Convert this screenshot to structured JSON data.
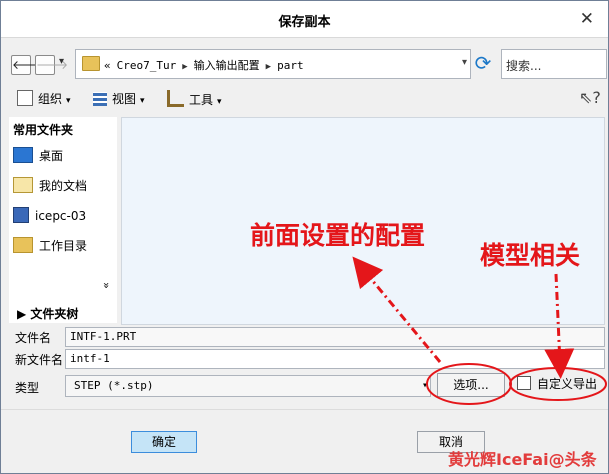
{
  "window": {
    "title": "保存副本",
    "close_glyph": "✕"
  },
  "nav": {
    "back_glyph": "🡐",
    "forward_glyph": "🡒",
    "dropdown_glyph": "▾"
  },
  "path": {
    "prefix": "«",
    "crumbs": [
      "Creo7_Tur",
      "输入输出配置",
      "part"
    ],
    "sep": "▶",
    "refresh_glyph": "⟳"
  },
  "search": {
    "placeholder": "搜索..."
  },
  "toolbar": {
    "organize": "组织",
    "view": "视图",
    "tools": "工具",
    "help_glyph": "⇖?"
  },
  "sidebar": {
    "heading": "常用文件夹",
    "items": [
      "桌面",
      "我的文档",
      "icepc-03",
      "工作目录"
    ],
    "more_glyph": "»",
    "tree_label": "文件夹树"
  },
  "fields": {
    "filename_label": "文件名",
    "filename_value": "INTF-1.PRT",
    "newname_label": "新文件名",
    "newname_value": "intf-1",
    "type_label": "类型",
    "type_value": "STEP (*.stp)"
  },
  "buttons": {
    "options": "选项...",
    "custom_export": "自定义导出",
    "ok": "确定",
    "cancel": "取消"
  },
  "annotations": {
    "front_settings": "前面设置的配置",
    "model_related": "模型相关"
  },
  "watermark": "黄光辉IceFai@头条",
  "colors": {
    "annotation": "#e4161a",
    "ok_button": "#c5e4f7",
    "file_pane": "#eef5fc"
  }
}
